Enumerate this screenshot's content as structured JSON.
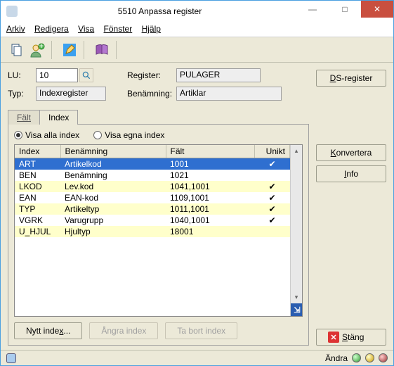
{
  "window": {
    "title": "5510 Anpassa register"
  },
  "menu": {
    "arkiv": "Arkiv",
    "redigera": "Redigera",
    "visa": "Visa",
    "fonster": "Fönster",
    "hjalp": "Hjälp"
  },
  "form": {
    "lu_label": "LU:",
    "lu_value": "10",
    "typ_label": "Typ:",
    "typ_value": "Indexregister",
    "register_label": "Register:",
    "register_value": "PULAGER",
    "benamning_label": "Benämning:",
    "benamning_value": "Artiklar"
  },
  "tabs": {
    "falt": "Fält",
    "index": "Index"
  },
  "radios": {
    "alla_prefix": "Visa ",
    "alla_u": "a",
    "alla_suffix": "lla index",
    "egna_prefix": "Visa ",
    "egna_u": "e",
    "egna_suffix": "gna index"
  },
  "columns": {
    "index": "Index",
    "benamning": "Benämning",
    "falt": "Fält",
    "unikt": "Unikt"
  },
  "rows": [
    {
      "index": "ART",
      "benamning": "Artikelkod",
      "falt": "1001",
      "unikt": true,
      "sel": true,
      "yel": false
    },
    {
      "index": "BEN",
      "benamning": "Benämning",
      "falt": "1021",
      "unikt": false,
      "sel": false,
      "yel": false
    },
    {
      "index": "LKOD",
      "benamning": "Lev.kod",
      "falt": "1041,1001",
      "unikt": true,
      "sel": false,
      "yel": true
    },
    {
      "index": "EAN",
      "benamning": "EAN-kod",
      "falt": "1109,1001",
      "unikt": true,
      "sel": false,
      "yel": false
    },
    {
      "index": "TYP",
      "benamning": "Artikeltyp",
      "falt": "1011,1001",
      "unikt": true,
      "sel": false,
      "yel": true
    },
    {
      "index": "VGRK",
      "benamning": "Varugrupp",
      "falt": "1040,1001",
      "unikt": true,
      "sel": false,
      "yel": false
    },
    {
      "index": "U_HJUL",
      "benamning": "Hjultyp",
      "falt": "18001",
      "unikt": false,
      "sel": false,
      "yel": true
    }
  ],
  "buttons": {
    "nytt_pre": "Nytt inde",
    "nytt_u": "x",
    "nytt_post": "...",
    "angra": "Ångra index",
    "tabort": "Ta bort index",
    "ds_u": "D",
    "ds_rest": "S-register",
    "konv_u": "K",
    "konv_rest": "onvertera",
    "info_u": "I",
    "info_rest": "nfo",
    "stang_u": "S",
    "stang_rest": "täng"
  },
  "status": {
    "andra": "Ändra"
  }
}
